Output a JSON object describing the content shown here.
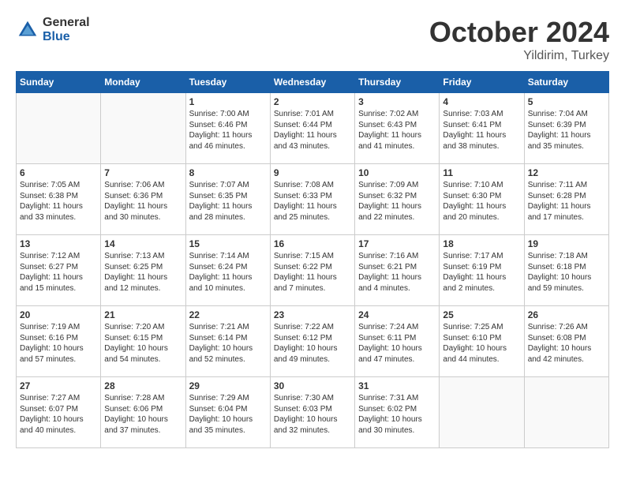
{
  "header": {
    "logo": {
      "general": "General",
      "blue": "Blue"
    },
    "title": "October 2024",
    "location": "Yildirim, Turkey"
  },
  "weekdays": [
    "Sunday",
    "Monday",
    "Tuesday",
    "Wednesday",
    "Thursday",
    "Friday",
    "Saturday"
  ],
  "weeks": [
    [
      {
        "day": "",
        "sunrise": "",
        "sunset": "",
        "daylight": ""
      },
      {
        "day": "",
        "sunrise": "",
        "sunset": "",
        "daylight": ""
      },
      {
        "day": "1",
        "sunrise": "Sunrise: 7:00 AM",
        "sunset": "Sunset: 6:46 PM",
        "daylight": "Daylight: 11 hours and 46 minutes."
      },
      {
        "day": "2",
        "sunrise": "Sunrise: 7:01 AM",
        "sunset": "Sunset: 6:44 PM",
        "daylight": "Daylight: 11 hours and 43 minutes."
      },
      {
        "day": "3",
        "sunrise": "Sunrise: 7:02 AM",
        "sunset": "Sunset: 6:43 PM",
        "daylight": "Daylight: 11 hours and 41 minutes."
      },
      {
        "day": "4",
        "sunrise": "Sunrise: 7:03 AM",
        "sunset": "Sunset: 6:41 PM",
        "daylight": "Daylight: 11 hours and 38 minutes."
      },
      {
        "day": "5",
        "sunrise": "Sunrise: 7:04 AM",
        "sunset": "Sunset: 6:39 PM",
        "daylight": "Daylight: 11 hours and 35 minutes."
      }
    ],
    [
      {
        "day": "6",
        "sunrise": "Sunrise: 7:05 AM",
        "sunset": "Sunset: 6:38 PM",
        "daylight": "Daylight: 11 hours and 33 minutes."
      },
      {
        "day": "7",
        "sunrise": "Sunrise: 7:06 AM",
        "sunset": "Sunset: 6:36 PM",
        "daylight": "Daylight: 11 hours and 30 minutes."
      },
      {
        "day": "8",
        "sunrise": "Sunrise: 7:07 AM",
        "sunset": "Sunset: 6:35 PM",
        "daylight": "Daylight: 11 hours and 28 minutes."
      },
      {
        "day": "9",
        "sunrise": "Sunrise: 7:08 AM",
        "sunset": "Sunset: 6:33 PM",
        "daylight": "Daylight: 11 hours and 25 minutes."
      },
      {
        "day": "10",
        "sunrise": "Sunrise: 7:09 AM",
        "sunset": "Sunset: 6:32 PM",
        "daylight": "Daylight: 11 hours and 22 minutes."
      },
      {
        "day": "11",
        "sunrise": "Sunrise: 7:10 AM",
        "sunset": "Sunset: 6:30 PM",
        "daylight": "Daylight: 11 hours and 20 minutes."
      },
      {
        "day": "12",
        "sunrise": "Sunrise: 7:11 AM",
        "sunset": "Sunset: 6:28 PM",
        "daylight": "Daylight: 11 hours and 17 minutes."
      }
    ],
    [
      {
        "day": "13",
        "sunrise": "Sunrise: 7:12 AM",
        "sunset": "Sunset: 6:27 PM",
        "daylight": "Daylight: 11 hours and 15 minutes."
      },
      {
        "day": "14",
        "sunrise": "Sunrise: 7:13 AM",
        "sunset": "Sunset: 6:25 PM",
        "daylight": "Daylight: 11 hours and 12 minutes."
      },
      {
        "day": "15",
        "sunrise": "Sunrise: 7:14 AM",
        "sunset": "Sunset: 6:24 PM",
        "daylight": "Daylight: 11 hours and 10 minutes."
      },
      {
        "day": "16",
        "sunrise": "Sunrise: 7:15 AM",
        "sunset": "Sunset: 6:22 PM",
        "daylight": "Daylight: 11 hours and 7 minutes."
      },
      {
        "day": "17",
        "sunrise": "Sunrise: 7:16 AM",
        "sunset": "Sunset: 6:21 PM",
        "daylight": "Daylight: 11 hours and 4 minutes."
      },
      {
        "day": "18",
        "sunrise": "Sunrise: 7:17 AM",
        "sunset": "Sunset: 6:19 PM",
        "daylight": "Daylight: 11 hours and 2 minutes."
      },
      {
        "day": "19",
        "sunrise": "Sunrise: 7:18 AM",
        "sunset": "Sunset: 6:18 PM",
        "daylight": "Daylight: 10 hours and 59 minutes."
      }
    ],
    [
      {
        "day": "20",
        "sunrise": "Sunrise: 7:19 AM",
        "sunset": "Sunset: 6:16 PM",
        "daylight": "Daylight: 10 hours and 57 minutes."
      },
      {
        "day": "21",
        "sunrise": "Sunrise: 7:20 AM",
        "sunset": "Sunset: 6:15 PM",
        "daylight": "Daylight: 10 hours and 54 minutes."
      },
      {
        "day": "22",
        "sunrise": "Sunrise: 7:21 AM",
        "sunset": "Sunset: 6:14 PM",
        "daylight": "Daylight: 10 hours and 52 minutes."
      },
      {
        "day": "23",
        "sunrise": "Sunrise: 7:22 AM",
        "sunset": "Sunset: 6:12 PM",
        "daylight": "Daylight: 10 hours and 49 minutes."
      },
      {
        "day": "24",
        "sunrise": "Sunrise: 7:24 AM",
        "sunset": "Sunset: 6:11 PM",
        "daylight": "Daylight: 10 hours and 47 minutes."
      },
      {
        "day": "25",
        "sunrise": "Sunrise: 7:25 AM",
        "sunset": "Sunset: 6:10 PM",
        "daylight": "Daylight: 10 hours and 44 minutes."
      },
      {
        "day": "26",
        "sunrise": "Sunrise: 7:26 AM",
        "sunset": "Sunset: 6:08 PM",
        "daylight": "Daylight: 10 hours and 42 minutes."
      }
    ],
    [
      {
        "day": "27",
        "sunrise": "Sunrise: 7:27 AM",
        "sunset": "Sunset: 6:07 PM",
        "daylight": "Daylight: 10 hours and 40 minutes."
      },
      {
        "day": "28",
        "sunrise": "Sunrise: 7:28 AM",
        "sunset": "Sunset: 6:06 PM",
        "daylight": "Daylight: 10 hours and 37 minutes."
      },
      {
        "day": "29",
        "sunrise": "Sunrise: 7:29 AM",
        "sunset": "Sunset: 6:04 PM",
        "daylight": "Daylight: 10 hours and 35 minutes."
      },
      {
        "day": "30",
        "sunrise": "Sunrise: 7:30 AM",
        "sunset": "Sunset: 6:03 PM",
        "daylight": "Daylight: 10 hours and 32 minutes."
      },
      {
        "day": "31",
        "sunrise": "Sunrise: 7:31 AM",
        "sunset": "Sunset: 6:02 PM",
        "daylight": "Daylight: 10 hours and 30 minutes."
      },
      {
        "day": "",
        "sunrise": "",
        "sunset": "",
        "daylight": ""
      },
      {
        "day": "",
        "sunrise": "",
        "sunset": "",
        "daylight": ""
      }
    ]
  ]
}
